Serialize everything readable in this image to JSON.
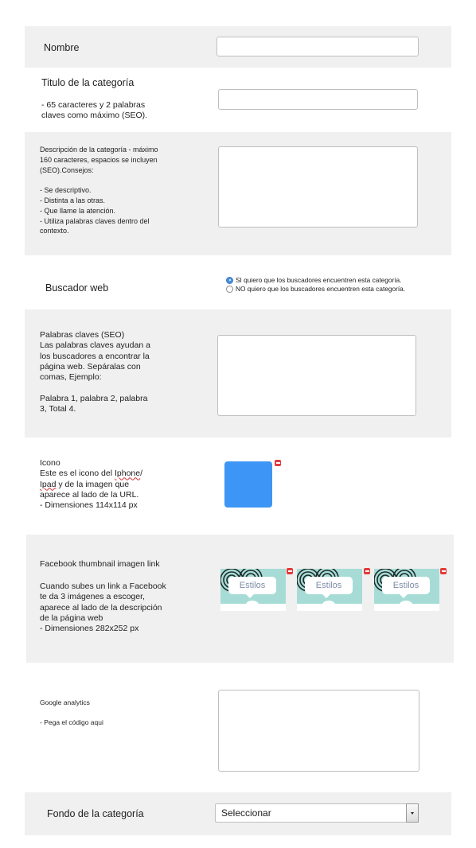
{
  "nombre": {
    "label": "Nombre",
    "value": ""
  },
  "titulo": {
    "label": "Titulo de la categoría",
    "hint": "- 65 caracteres y 2 palabras\nclaves como máximo (SEO).",
    "value": ""
  },
  "descripcion": {
    "label": "Descripción de la categoría - máximo\n160 caracteres, espacios se incluyen\n(SEO).Consejos:\n\n- Se descriptivo.\n- Distinta a las otras.\n- Que llame la atención.\n- Utiliza palabras claves dentro del\ncontexto.",
    "value": ""
  },
  "buscador": {
    "label": "Buscador web",
    "options": [
      {
        "label": "SI quiero que los buscadores encuentren esta categoría.",
        "selected": true
      },
      {
        "label": "NO quiero que los buscadores encuentren esta categoría.",
        "selected": false
      }
    ]
  },
  "palabras": {
    "label": "Palabras claves (SEO)\nLas palabras claves ayudan a\nlos buscadores a encontrar la\npágina web. Sepáralas con\ncomas, Ejemplo:\n\n Palabra 1, palabra 2, palabra\n3, Total 4.",
    "value": ""
  },
  "icono": {
    "title": "Icono",
    "line1_pre": "Este es el icono del ",
    "line1_word": "Iphone",
    "line1_post": "/",
    "line2_word": "Ipad",
    "line2_post": " y de la imagen que",
    "rest": "aparece al lado de la URL.\n- Dimensiones 114x114 px",
    "color": "#3d96f5"
  },
  "facebook": {
    "title": "Facebook thumbnail imagen link",
    "description": "Cuando subes un link a Facebook\nte da 3 imágenes a escoger,\naparece al lado de la descripción\nde la página web\n- Dimensiones 282x252 px",
    "thumbnails": [
      {
        "label": "Estilos"
      },
      {
        "label": "Estilos"
      },
      {
        "label": "Estilos"
      }
    ]
  },
  "analytics": {
    "title": "Google analytics",
    "hint": "- Pega el código aqui",
    "value": ""
  },
  "fondo": {
    "label": "Fondo de la categoría",
    "selected": "Seleccionar"
  },
  "colors": {
    "band": "#f0f0f0",
    "radio_selected": "#4a90e2",
    "delete": "#e23b3b",
    "thumb_bg": "#a7dcd6"
  }
}
